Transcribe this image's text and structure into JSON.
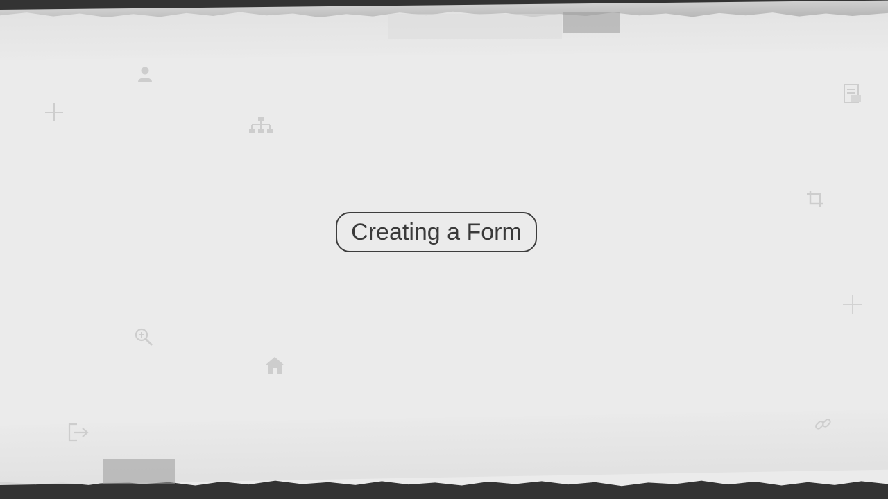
{
  "title": "Creating a Form",
  "colors": {
    "background_edge": "#333333",
    "paper": "#ebebeb",
    "text": "#3a3a3a",
    "faint_icon": "#cfcfcf"
  },
  "decor_icons": [
    "user-icon",
    "plus-icon",
    "sitemap-icon",
    "document-icon",
    "crop-icon",
    "zoom-in-icon",
    "home-icon",
    "plus-icon",
    "exit-icon",
    "link-icon"
  ]
}
